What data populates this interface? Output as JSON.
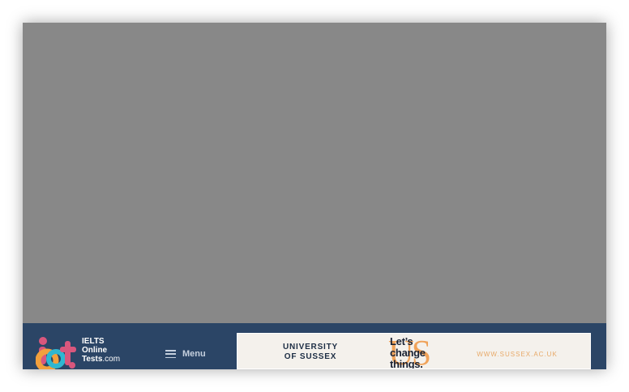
{
  "site": {
    "logo_line1": "IELTS",
    "logo_line2": "Online",
    "logo_line3_bold": "Tests",
    "logo_line3_suffix": ".com",
    "logo_mark_letters": "iot"
  },
  "nav": {
    "menu_label": "Menu"
  },
  "ad": {
    "university_line1": "UNIVERSITY",
    "university_line2": "OF SUSSEX",
    "us_mark": "US",
    "slogan_line1": "Let’s",
    "slogan_line2": "change",
    "slogan_line3": "things.",
    "url": "WWW.SUSSEX.AC.UK"
  },
  "colors": {
    "overlay": "#888888",
    "header_bg": "#2b4566",
    "ad_bg": "#f4f1ec",
    "accent_orange": "#f0a35a",
    "logo_pink": "#d9577d",
    "logo_orange": "#f2a03d",
    "logo_teal": "#2fb7d1"
  },
  "icons": {
    "menu": "hamburger-icon"
  }
}
